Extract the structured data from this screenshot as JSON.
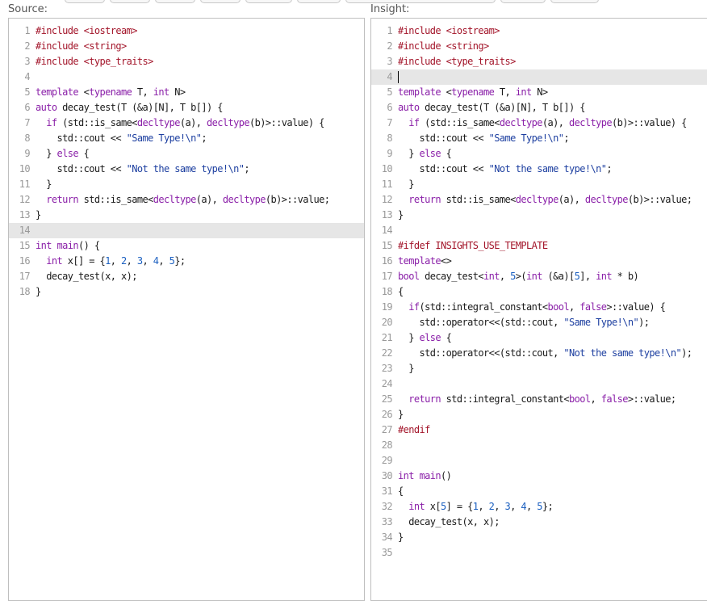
{
  "source": {
    "label": "Source:",
    "active_line": 14,
    "lines": [
      [
        [
          "pp",
          "#include <iostream>"
        ]
      ],
      [
        [
          "pp",
          "#include <string>"
        ]
      ],
      [
        [
          "pp",
          "#include <type_traits>"
        ]
      ],
      [],
      [
        [
          "kw",
          "template"
        ],
        [
          "txt",
          " <"
        ],
        [
          "kw",
          "typename"
        ],
        [
          "txt",
          " T, "
        ],
        [
          "kw",
          "int"
        ],
        [
          "txt",
          " N>"
        ]
      ],
      [
        [
          "kw",
          "auto"
        ],
        [
          "txt",
          " decay_test(T (&a)[N], T b[]) {"
        ]
      ],
      [
        [
          "txt",
          "  "
        ],
        [
          "kw",
          "if"
        ],
        [
          "txt",
          " (std::is_same<"
        ],
        [
          "kw",
          "decltype"
        ],
        [
          "txt",
          "(a), "
        ],
        [
          "kw",
          "decltype"
        ],
        [
          "txt",
          "(b)>::value) {"
        ]
      ],
      [
        [
          "txt",
          "    std::cout << "
        ],
        [
          "str",
          "\"Same Type!\\n\""
        ],
        [
          "txt",
          ";"
        ]
      ],
      [
        [
          "txt",
          "  } "
        ],
        [
          "kw",
          "else"
        ],
        [
          "txt",
          " {"
        ]
      ],
      [
        [
          "txt",
          "    std::cout << "
        ],
        [
          "str",
          "\"Not the same type!\\n\""
        ],
        [
          "txt",
          ";"
        ]
      ],
      [
        [
          "txt",
          "  }"
        ]
      ],
      [
        [
          "txt",
          "  "
        ],
        [
          "kw",
          "return"
        ],
        [
          "txt",
          " std::is_same<"
        ],
        [
          "kw",
          "decltype"
        ],
        [
          "txt",
          "(a), "
        ],
        [
          "kw",
          "decltype"
        ],
        [
          "txt",
          "(b)>::value;"
        ]
      ],
      [
        [
          "txt",
          "}"
        ]
      ],
      [],
      [
        [
          "kw",
          "int"
        ],
        [
          "txt",
          " "
        ],
        [
          "kw",
          "main"
        ],
        [
          "txt",
          "() {"
        ]
      ],
      [
        [
          "txt",
          "  "
        ],
        [
          "kw",
          "int"
        ],
        [
          "txt",
          " x[] = {"
        ],
        [
          "num",
          "1"
        ],
        [
          "txt",
          ", "
        ],
        [
          "num",
          "2"
        ],
        [
          "txt",
          ", "
        ],
        [
          "num",
          "3"
        ],
        [
          "txt",
          ", "
        ],
        [
          "num",
          "4"
        ],
        [
          "txt",
          ", "
        ],
        [
          "num",
          "5"
        ],
        [
          "txt",
          "};"
        ]
      ],
      [
        [
          "txt",
          "  decay_test(x, x);"
        ]
      ],
      [
        [
          "txt",
          "}"
        ]
      ]
    ]
  },
  "insight": {
    "label": "Insight:",
    "active_line": 4,
    "lines": [
      [
        [
          "pp",
          "#include <iostream>"
        ]
      ],
      [
        [
          "pp",
          "#include <string>"
        ]
      ],
      [
        [
          "pp",
          "#include <type_traits>"
        ]
      ],
      [],
      [
        [
          "kw",
          "template"
        ],
        [
          "txt",
          " <"
        ],
        [
          "kw",
          "typename"
        ],
        [
          "txt",
          " T, "
        ],
        [
          "kw",
          "int"
        ],
        [
          "txt",
          " N>"
        ]
      ],
      [
        [
          "kw",
          "auto"
        ],
        [
          "txt",
          " decay_test(T (&a)[N], T b[]) {"
        ]
      ],
      [
        [
          "txt",
          "  "
        ],
        [
          "kw",
          "if"
        ],
        [
          "txt",
          " (std::is_same<"
        ],
        [
          "kw",
          "decltype"
        ],
        [
          "txt",
          "(a), "
        ],
        [
          "kw",
          "decltype"
        ],
        [
          "txt",
          "(b)>::value) {"
        ]
      ],
      [
        [
          "txt",
          "    std::cout << "
        ],
        [
          "str",
          "\"Same Type!\\n\""
        ],
        [
          "txt",
          ";"
        ]
      ],
      [
        [
          "txt",
          "  } "
        ],
        [
          "kw",
          "else"
        ],
        [
          "txt",
          " {"
        ]
      ],
      [
        [
          "txt",
          "    std::cout << "
        ],
        [
          "str",
          "\"Not the same type!\\n\""
        ],
        [
          "txt",
          ";"
        ]
      ],
      [
        [
          "txt",
          "  }"
        ]
      ],
      [
        [
          "txt",
          "  "
        ],
        [
          "kw",
          "return"
        ],
        [
          "txt",
          " std::is_same<"
        ],
        [
          "kw",
          "decltype"
        ],
        [
          "txt",
          "(a), "
        ],
        [
          "kw",
          "decltype"
        ],
        [
          "txt",
          "(b)>::value;"
        ]
      ],
      [
        [
          "txt",
          "}"
        ]
      ],
      [],
      [
        [
          "pp",
          "#ifdef INSIGHTS_USE_TEMPLATE"
        ]
      ],
      [
        [
          "kw",
          "template"
        ],
        [
          "txt",
          "<>"
        ]
      ],
      [
        [
          "kw",
          "bool"
        ],
        [
          "txt",
          " decay_test<"
        ],
        [
          "kw",
          "int"
        ],
        [
          "txt",
          ", "
        ],
        [
          "num",
          "5"
        ],
        [
          "txt",
          ">("
        ],
        [
          "kw",
          "int"
        ],
        [
          "txt",
          " (&a)["
        ],
        [
          "num",
          "5"
        ],
        [
          "txt",
          "], "
        ],
        [
          "kw",
          "int"
        ],
        [
          "txt",
          " * b)"
        ]
      ],
      [
        [
          "txt",
          "{"
        ]
      ],
      [
        [
          "txt",
          "  "
        ],
        [
          "kw",
          "if"
        ],
        [
          "txt",
          "(std::integral_constant<"
        ],
        [
          "kw",
          "bool"
        ],
        [
          "txt",
          ", "
        ],
        [
          "kw",
          "false"
        ],
        [
          "txt",
          ">::value) {"
        ]
      ],
      [
        [
          "txt",
          "    std::operator<<(std::cout, "
        ],
        [
          "str",
          "\"Same Type!\\n\""
        ],
        [
          "txt",
          ");"
        ]
      ],
      [
        [
          "txt",
          "  } "
        ],
        [
          "kw",
          "else"
        ],
        [
          "txt",
          " {"
        ]
      ],
      [
        [
          "txt",
          "    std::operator<<(std::cout, "
        ],
        [
          "str",
          "\"Not the same type!\\n\""
        ],
        [
          "txt",
          ");"
        ]
      ],
      [
        [
          "txt",
          "  }"
        ]
      ],
      [],
      [
        [
          "txt",
          "  "
        ],
        [
          "kw",
          "return"
        ],
        [
          "txt",
          " std::integral_constant<"
        ],
        [
          "kw",
          "bool"
        ],
        [
          "txt",
          ", "
        ],
        [
          "kw",
          "false"
        ],
        [
          "txt",
          ">::value;"
        ]
      ],
      [
        [
          "txt",
          "}"
        ]
      ],
      [
        [
          "pp",
          "#endif"
        ]
      ],
      [],
      [],
      [
        [
          "kw",
          "int"
        ],
        [
          "txt",
          " "
        ],
        [
          "kw",
          "main"
        ],
        [
          "txt",
          "()"
        ]
      ],
      [
        [
          "txt",
          "{"
        ]
      ],
      [
        [
          "txt",
          "  "
        ],
        [
          "kw",
          "int"
        ],
        [
          "txt",
          " x["
        ],
        [
          "num",
          "5"
        ],
        [
          "txt",
          "] = {"
        ],
        [
          "num",
          "1"
        ],
        [
          "txt",
          ", "
        ],
        [
          "num",
          "2"
        ],
        [
          "txt",
          ", "
        ],
        [
          "num",
          "3"
        ],
        [
          "txt",
          ", "
        ],
        [
          "num",
          "4"
        ],
        [
          "txt",
          ", "
        ],
        [
          "num",
          "5"
        ],
        [
          "txt",
          "};"
        ]
      ],
      [
        [
          "txt",
          "  decay_test(x, x);"
        ]
      ],
      [
        [
          "txt",
          "}"
        ]
      ],
      []
    ]
  }
}
